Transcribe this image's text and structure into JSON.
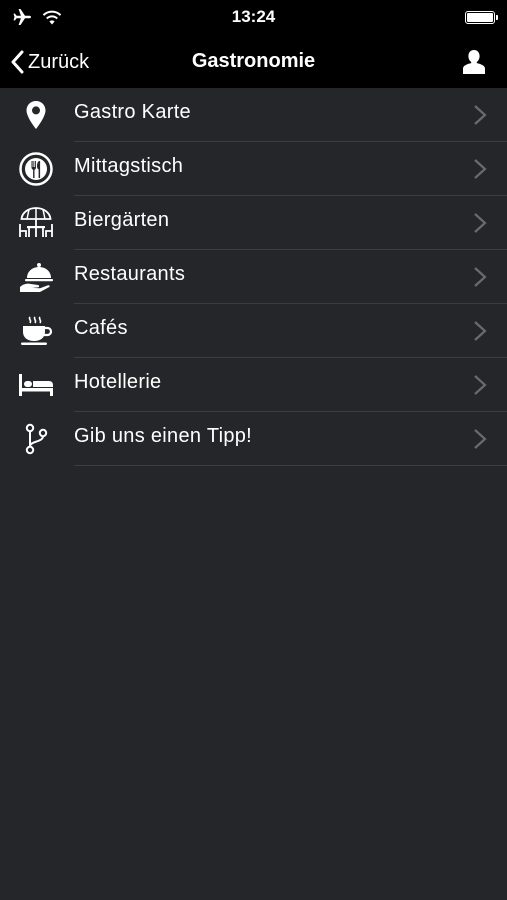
{
  "status": {
    "time": "13:24"
  },
  "nav": {
    "back_label": "Zurück",
    "title": "Gastronomie"
  },
  "menu": {
    "items": [
      {
        "label": "Gastro Karte",
        "icon": "map-pin-icon"
      },
      {
        "label": "Mittagstisch",
        "icon": "plate-cutlery-icon"
      },
      {
        "label": "Biergärten",
        "icon": "beer-garden-umbrella-icon"
      },
      {
        "label": "Restaurants",
        "icon": "serving-cloche-icon"
      },
      {
        "label": "Cafés",
        "icon": "coffee-cup-icon"
      },
      {
        "label": "Hotellerie",
        "icon": "bed-icon"
      },
      {
        "label": "Gib uns einen Tipp!",
        "icon": "branch-tip-icon"
      }
    ]
  },
  "colors": {
    "background": "#252629",
    "bar": "#000000",
    "separator": "#3c3d41",
    "chevron": "#6a6b6f"
  }
}
